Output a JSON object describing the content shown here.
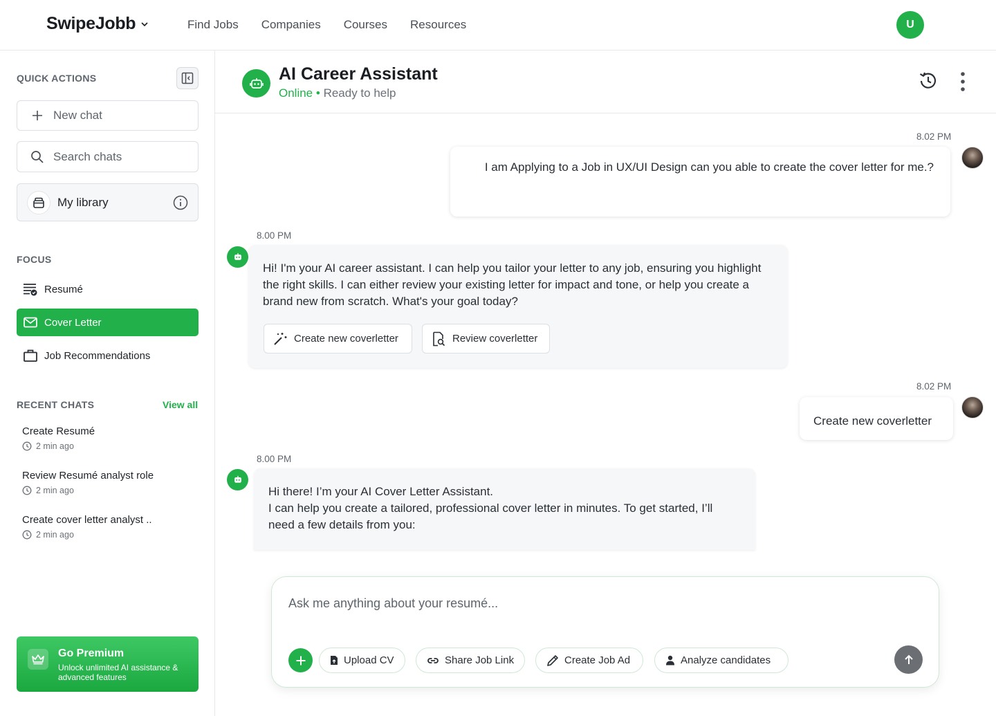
{
  "brand": {
    "name": "SwipeJobb"
  },
  "nav": {
    "items": [
      "Find Jobs",
      "Companies",
      "Courses",
      "Resources"
    ]
  },
  "user": {
    "initial": "U"
  },
  "sidebar": {
    "quick_actions_title": "QUICK ACTIONS",
    "new_chat": "New chat",
    "search_chats": "Search chats",
    "library": "My library",
    "focus_title": "FOCUS",
    "focus_items": [
      {
        "label": "Resumé",
        "icon": "resume-list-icon"
      },
      {
        "label": "Cover Letter",
        "icon": "envelope-icon"
      },
      {
        "label": "Job Recommendations",
        "icon": "briefcase-icon"
      }
    ],
    "recent_title": "RECENT CHATS",
    "view_all": "View all",
    "recent_chats": [
      {
        "title": "Create Resumé",
        "time": "2 min ago"
      },
      {
        "title": "Review Resumé analyst role",
        "time": "2 min ago"
      },
      {
        "title": "Create cover letter analyst ..",
        "time": "2 min ago"
      }
    ],
    "premium": {
      "title": "Go Premium",
      "subtitle": "Unlock unlimited AI assistance & advanced features"
    }
  },
  "chat": {
    "title": "AI Career Assistant",
    "status_online": "Online",
    "status_separator": "•",
    "status_text": "Ready to help",
    "messages": [
      {
        "from": "user",
        "time": "8.02 PM",
        "text": "I am Applying to a Job in UX/UI Design can you able to create the cover letter for me.?"
      },
      {
        "from": "bot",
        "time": "8.00 PM",
        "text": "Hi! I'm your AI career assistant. I can help you tailor your letter to any job, ensuring you highlight the right skills. I can either review your existing letter for impact and tone, or help you create a brand new from scratch. What's your goal today?",
        "options": [
          {
            "label": "Create new coverletter",
            "icon": "magic-wand-icon"
          },
          {
            "label": "Review coverletter",
            "icon": "document-search-icon"
          }
        ]
      },
      {
        "from": "user",
        "time": "8.02 PM",
        "text": "Create new coverletter"
      },
      {
        "from": "bot",
        "time": "8.00 PM",
        "line1": "Hi there! I’m your AI Cover Letter Assistant.",
        "line2": "I can help you create a tailored, professional cover letter in minutes. To get started, I’ll need a few details from you:"
      }
    ]
  },
  "composer": {
    "placeholder": "Ask me anything about your resumé...",
    "chips": [
      {
        "label": "Upload CV",
        "icon": "file-upload-icon"
      },
      {
        "label": "Share Job Link",
        "icon": "link-icon"
      },
      {
        "label": "Create Job Ad",
        "icon": "pencil-icon"
      },
      {
        "label": "Analyze candidates",
        "icon": "user-icon"
      }
    ]
  },
  "colors": {
    "accent": "#22b04b",
    "send_button": "#6b6f74"
  }
}
